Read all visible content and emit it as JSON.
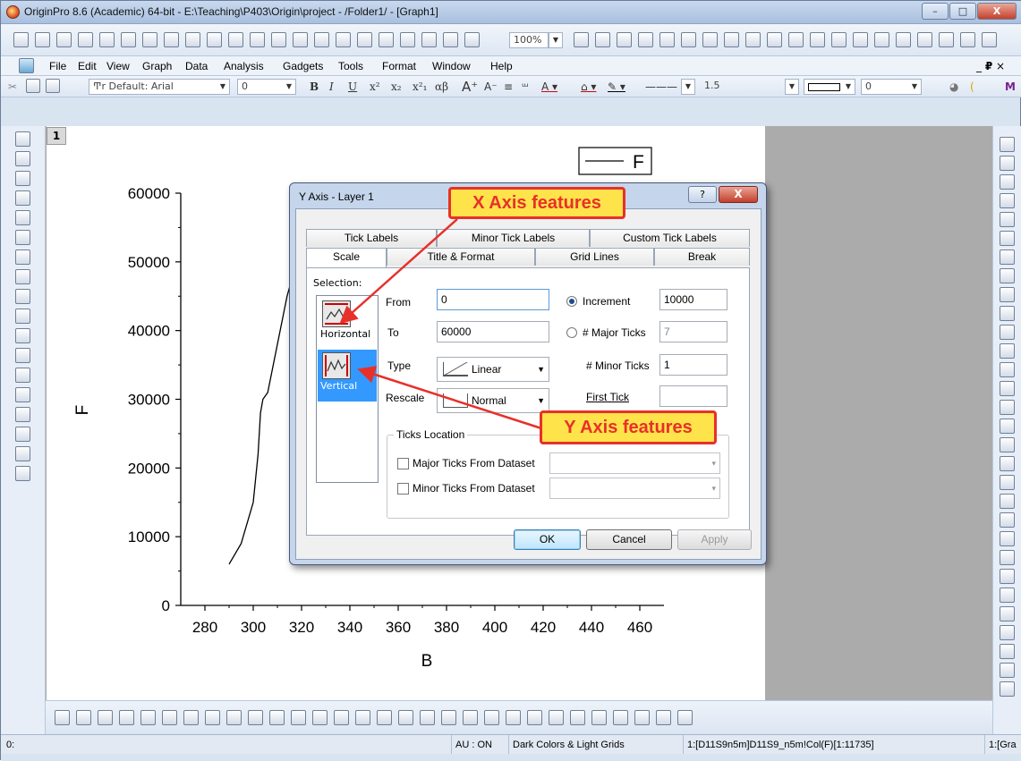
{
  "window": {
    "title": "OriginPro 8.6 (Academic) 64-bit - E:\\Teaching\\P403\\Origin\\project - /Folder1/ - [Graph1]",
    "controls": {
      "minimize": "–",
      "maximize": "□",
      "close": "X"
    }
  },
  "toolbar": {
    "zoom_value": "100%"
  },
  "menu": {
    "items": [
      "File",
      "Edit",
      "View",
      "Graph",
      "Data",
      "Analysis",
      "Gadgets",
      "Tools",
      "Format",
      "Window",
      "Help"
    ],
    "mdi_controls": "_ ＆ ×"
  },
  "format_toolbar": {
    "font": "Default: Arial",
    "font_size": "0",
    "bold": "B",
    "italic": "I",
    "underline": "U",
    "superscript": "x²",
    "subscript": "x₂",
    "supsub": "x²₁",
    "greek": "αβ",
    "line_width": "1.5",
    "pattern_value": "0",
    "pattern_value2": "0"
  },
  "graph": {
    "layer_number": "1",
    "legend_label": "F",
    "x_axis_title": "B",
    "y_axis_title": "F",
    "x_ticks": [
      "280",
      "300",
      "320",
      "340",
      "360",
      "380",
      "400",
      "420",
      "440",
      "460"
    ],
    "y_ticks": [
      "0",
      "10000",
      "20000",
      "30000",
      "40000",
      "50000",
      "60000"
    ]
  },
  "chart_data": {
    "type": "line",
    "xlabel": "B",
    "ylabel": "F",
    "xlim": [
      270,
      470
    ],
    "ylim": [
      0,
      60000
    ],
    "series": [
      {
        "name": "F",
        "x": [
          290,
          295,
          300,
          302,
          303,
          304,
          306,
          310,
          314,
          318
        ],
        "y": [
          6000,
          9000,
          15000,
          22000,
          28000,
          30000,
          31000,
          38000,
          45000,
          50000
        ]
      }
    ],
    "legend_position": "top-right"
  },
  "dialog": {
    "title": "Y Axis - Layer 1",
    "help": "?",
    "close": "X",
    "tabs_row1": [
      "Tick Labels",
      "Minor Tick Labels",
      "Custom Tick Labels"
    ],
    "tabs_row2": [
      "Scale",
      "Title & Format",
      "Grid Lines",
      "Break"
    ],
    "selection_label": "Selection:",
    "selection_items": [
      "Horizontal",
      "Vertical"
    ],
    "from_label": "From",
    "from_value": "0",
    "to_label": "To",
    "to_value": "60000",
    "type_label": "Type",
    "type_value": "Linear",
    "rescale_label": "Rescale",
    "rescale_value": "Normal",
    "increment_label": "Increment",
    "increment_value": "10000",
    "major_ticks_label": "# Major Ticks",
    "major_ticks_value": "7",
    "minor_ticks_label": "# Minor Ticks",
    "minor_ticks_value": "1",
    "first_tick_label": "First Tick",
    "ticks_location_label": "Ticks Location",
    "major_from_dataset": "Major Ticks From Dataset",
    "minor_from_dataset": "Minor Ticks From Dataset",
    "ok": "OK",
    "cancel": "Cancel",
    "apply": "Apply"
  },
  "callouts": {
    "x_axis": "X Axis features",
    "y_axis": "Y Axis features"
  },
  "status": {
    "left": "0:",
    "au": "AU : ON",
    "theme": "Dark Colors & Light Grids",
    "dataset": "1:[D11S9n5m]D11S9_n5m!Col(F)[1:11735]",
    "right": "1:[Gra"
  },
  "colors": {
    "callout_bg": "#ffe34a",
    "callout_border": "#e8302a",
    "selection": "#3399ff"
  }
}
